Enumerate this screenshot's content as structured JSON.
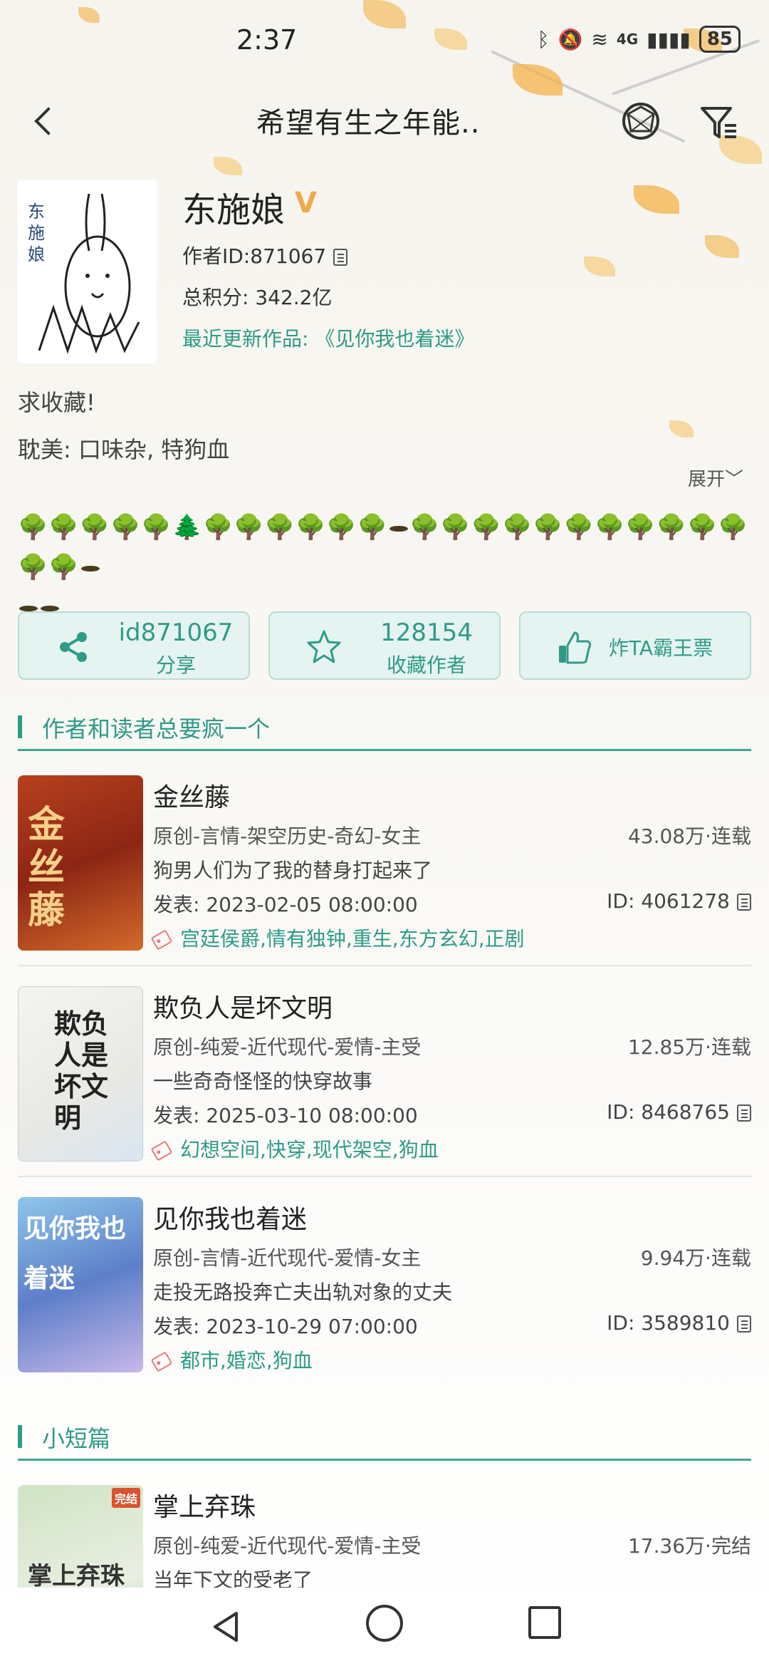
{
  "status_bar": {
    "time": "2:37",
    "network": "4G",
    "battery": "85"
  },
  "nav": {
    "title": "希望有生之年能..",
    "back_icon": "back-arrow-icon",
    "icons": [
      "theme-icon",
      "filter-icon"
    ]
  },
  "author": {
    "name": "东施娘",
    "badge": "V",
    "id_label": "作者ID:871067",
    "score_label": "总积分:  342.2亿",
    "recent_label": "最近更新作品: 《见你我也着迷》",
    "intro_line1": "求收藏!",
    "intro_line2": "耽美: 口味杂, 特狗血",
    "expand_label": "展开",
    "avatar_text": "东施娘"
  },
  "trees": {
    "row1": "🌳🌳🌳🌳🌳🌲🌳🌳🌳🌳🌳🌳",
    "row1b": "🌳🌳🌳🌳🌳🌳🌳🌳🌳🌳🌳🌳🌳"
  },
  "actions": [
    {
      "icon": "share-icon",
      "main": "id871067",
      "sub": "分享"
    },
    {
      "icon": "star-icon",
      "main": "128154",
      "sub": "收藏作者"
    },
    {
      "icon": "thumbs-up-icon",
      "label": "炸TA霸王票"
    }
  ],
  "sections": [
    {
      "label": "作者和读者总要疯一个"
    },
    {
      "label": "小短篇"
    }
  ],
  "books": [
    {
      "title": "金丝藤",
      "category": "原创-言情-架空历史-奇幻-女主",
      "stat": "43.08万·连载",
      "desc": "狗男人们为了我的替身打起来了",
      "date": "发表:  2023-02-05 08:00:00",
      "id": "ID: 4061278",
      "tags": "宫廷侯爵,情有独钟,重生,东方玄幻,正剧",
      "cover_text": "金丝藤"
    },
    {
      "title": "欺负人是坏文明",
      "category": "原创-纯爱-近代现代-爱情-主受",
      "stat": "12.85万·连载",
      "desc": "一些奇奇怪怪的快穿故事",
      "date": "发表:  2025-03-10 08:00:00",
      "id": "ID: 8468765",
      "tags": "幻想空间,快穿,现代架空,狗血",
      "cover_text": "欺负人是坏文明"
    },
    {
      "title": "见你我也着迷",
      "category": "原创-言情-近代现代-爱情-女主",
      "stat": "9.94万·连载",
      "desc": "走投无路投奔亡夫出轨对象的丈夫",
      "date": "发表:  2023-10-29 07:00:00",
      "id": "ID: 3589810",
      "tags": "都市,婚恋,狗血",
      "cover_text": "见你我也着迷"
    },
    {
      "title": "掌上弃珠",
      "category": "原创-纯爱-近代现代-爱情-主受",
      "stat": "17.36万·完结",
      "desc": "当年下文的受老了",
      "cover_text": "掌上弃珠",
      "cover_badge": "完结"
    }
  ],
  "colors": {
    "accent": "#2e9b87",
    "badge": "#f0a94a",
    "tag": "#e87b7b"
  }
}
